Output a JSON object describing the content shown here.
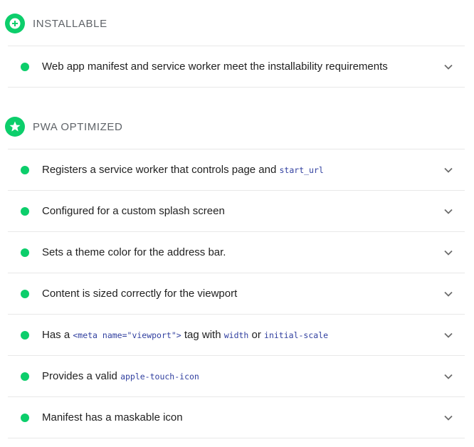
{
  "groups": [
    {
      "title": "INSTALLABLE",
      "icon": "plus-icon",
      "audits": [
        {
          "parts": [
            {
              "t": "text",
              "v": "Web app manifest and service worker meet the installability requirements"
            }
          ]
        }
      ]
    },
    {
      "title": "PWA OPTIMIZED",
      "icon": "star-icon",
      "audits": [
        {
          "parts": [
            {
              "t": "text",
              "v": "Registers a service worker that controls page and "
            },
            {
              "t": "code",
              "v": "start_url"
            }
          ]
        },
        {
          "parts": [
            {
              "t": "text",
              "v": "Configured for a custom splash screen"
            }
          ]
        },
        {
          "parts": [
            {
              "t": "text",
              "v": "Sets a theme color for the address bar."
            }
          ]
        },
        {
          "parts": [
            {
              "t": "text",
              "v": "Content is sized correctly for the viewport"
            }
          ]
        },
        {
          "parts": [
            {
              "t": "text",
              "v": "Has a "
            },
            {
              "t": "code",
              "v": "<meta name=\"viewport\">"
            },
            {
              "t": "text",
              "v": " tag with "
            },
            {
              "t": "code",
              "v": "width"
            },
            {
              "t": "text",
              "v": " or "
            },
            {
              "t": "code",
              "v": "initial-scale"
            }
          ]
        },
        {
          "parts": [
            {
              "t": "text",
              "v": "Provides a valid "
            },
            {
              "t": "code",
              "v": "apple-touch-icon"
            }
          ]
        },
        {
          "parts": [
            {
              "t": "text",
              "v": "Manifest has a maskable icon"
            }
          ]
        }
      ]
    }
  ],
  "colors": {
    "pass": "#0cce6b",
    "code": "#303f9f",
    "header": "#5f6368",
    "divider": "#e8e8e8"
  }
}
